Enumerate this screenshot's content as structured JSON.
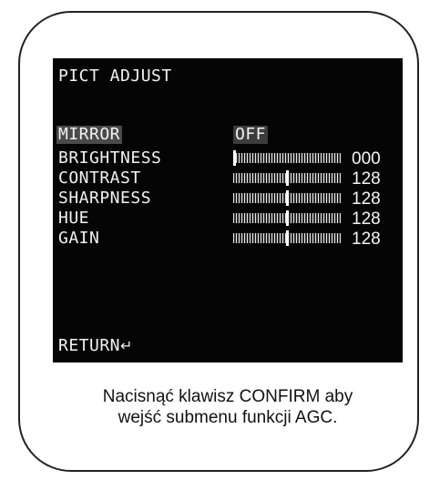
{
  "menu": {
    "title": "PICT ADJUST",
    "rows": [
      {
        "label": "MIRROR",
        "value": "OFF",
        "type": "toggle",
        "selected": true
      },
      {
        "label": "BRIGHTNESS",
        "value": "000",
        "type": "slider",
        "level": 0
      },
      {
        "label": "CONTRAST",
        "value": "128",
        "type": "slider",
        "level": 0.5
      },
      {
        "label": "SHARPNESS",
        "value": "128",
        "type": "slider",
        "level": 0.5
      },
      {
        "label": "HUE",
        "value": "128",
        "type": "slider",
        "level": 0.5
      },
      {
        "label": "GAIN",
        "value": "128",
        "type": "slider",
        "level": 0.5
      }
    ],
    "return_label": "RETURN",
    "return_icon": "enter-arrow-icon"
  },
  "caption": {
    "line1": "Nacisnąć klawisz CONFIRM aby",
    "line2": "wejść submenu funkcji AGC."
  }
}
